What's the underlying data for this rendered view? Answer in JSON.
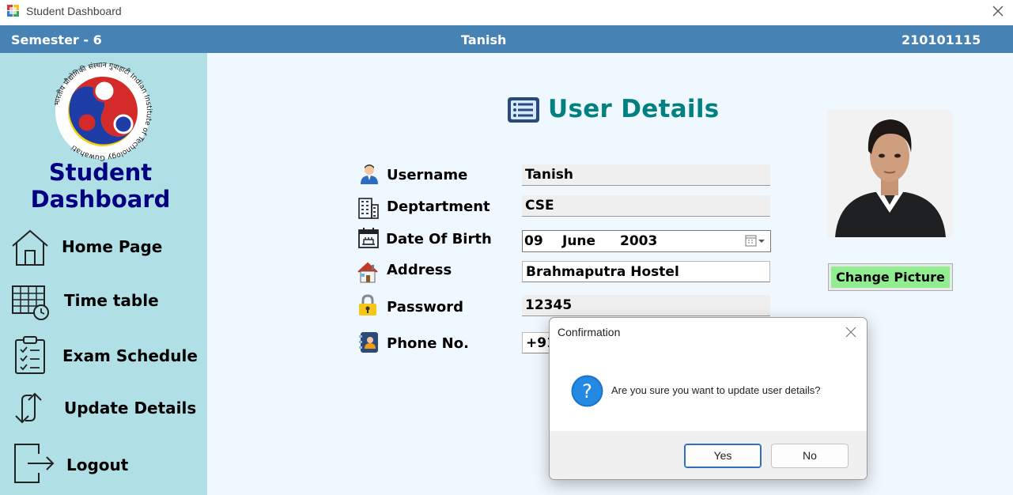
{
  "window": {
    "title": "Student Dashboard",
    "icons": [
      "app-icon",
      "close-icon"
    ]
  },
  "header": {
    "semester": "Semester - 6",
    "student_name": "Tanish",
    "roll_number": "210101115"
  },
  "sidebar": {
    "logo_text": "भारतीय प्रौद्योगिकी संस्थान गुवाहाटी Indian Institute of Technology Guwahati",
    "title_line1": "Student",
    "title_line2": "Dashboard",
    "items": [
      {
        "label": "Home Page",
        "icon": "home-icon"
      },
      {
        "label": "Time table",
        "icon": "timetable-icon"
      },
      {
        "label": "Exam Schedule",
        "icon": "clipboard-icon"
      },
      {
        "label": "Update Details",
        "icon": "update-arrows-icon"
      },
      {
        "label": "Logout",
        "icon": "logout-icon"
      }
    ]
  },
  "main": {
    "heading": "User Details",
    "fields": {
      "username": {
        "label": "Username",
        "value": "Tanish"
      },
      "department": {
        "label": "Deptartment",
        "value": "CSE"
      },
      "dob": {
        "label": "Date Of Birth",
        "day": "09",
        "month": "June",
        "year": "2003"
      },
      "address": {
        "label": "Address",
        "value": "Brahmaputra Hostel"
      },
      "password": {
        "label": "Password",
        "value": "12345"
      },
      "phone": {
        "label": "Phone No.",
        "value": "+91"
      }
    },
    "change_picture_label": "Change Picture"
  },
  "dialog": {
    "title": "Confirmation",
    "message": "Are you sure you want to update user details?",
    "yes_label": "Yes",
    "no_label": "No"
  },
  "colors": {
    "header_bg": "#4682b4",
    "sidebar_bg": "#b0e0e6",
    "main_bg": "#f0f8ff",
    "brand_text": "#000080",
    "heading_text": "#008080",
    "change_picture_bg": "#90ee90",
    "dialog_accent": "#2e6fc0"
  }
}
